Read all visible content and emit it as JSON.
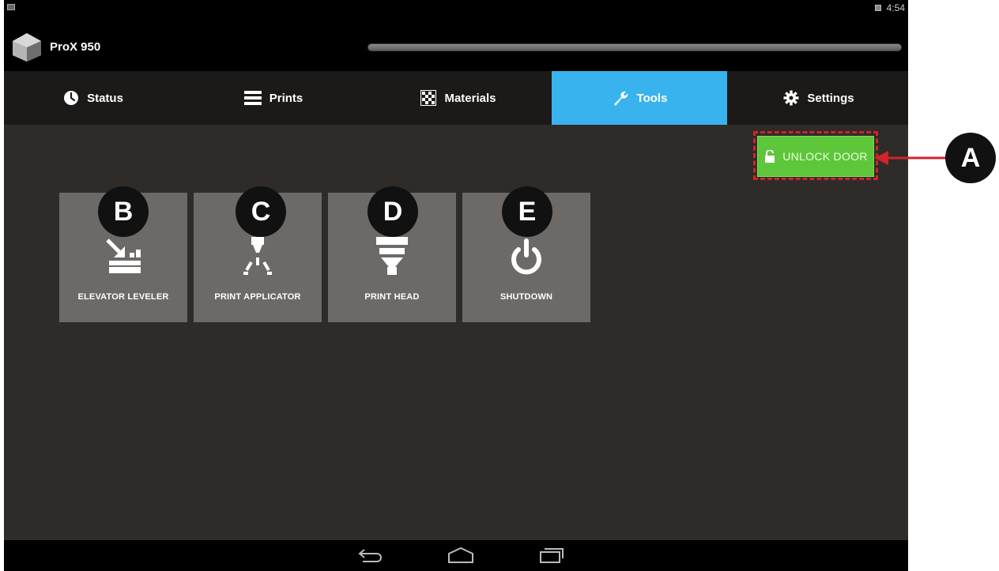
{
  "status_bar": {
    "time": "4:54"
  },
  "app": {
    "title": "ProX 950"
  },
  "tabs": [
    {
      "label": "Status",
      "icon": "clock-icon",
      "active": false
    },
    {
      "label": "Prints",
      "icon": "list-icon",
      "active": false
    },
    {
      "label": "Materials",
      "icon": "checker-icon",
      "active": false
    },
    {
      "label": "Tools",
      "icon": "wrench-icon",
      "active": true
    },
    {
      "label": "Settings",
      "icon": "gear-icon",
      "active": false
    }
  ],
  "unlock_door": {
    "label": "UNLOCK DOOR",
    "icon": "unlock-icon",
    "callout": "A"
  },
  "tools": [
    {
      "label": "ELEVATOR LEVELER",
      "icon": "elevator-leveler-icon",
      "callout": "B"
    },
    {
      "label": "PRINT APPLICATOR",
      "icon": "print-applicator-icon",
      "callout": "C"
    },
    {
      "label": "PRINT HEAD",
      "icon": "print-head-icon",
      "callout": "D"
    },
    {
      "label": "SHUTDOWN",
      "icon": "power-icon",
      "callout": "E"
    }
  ],
  "nav": [
    "back-icon",
    "home-icon",
    "recent-apps-icon"
  ],
  "colors": {
    "accent": "#39b3ee",
    "unlock": "#5ec63a",
    "highlight": "#d2232a",
    "background": "#2e2b29"
  }
}
